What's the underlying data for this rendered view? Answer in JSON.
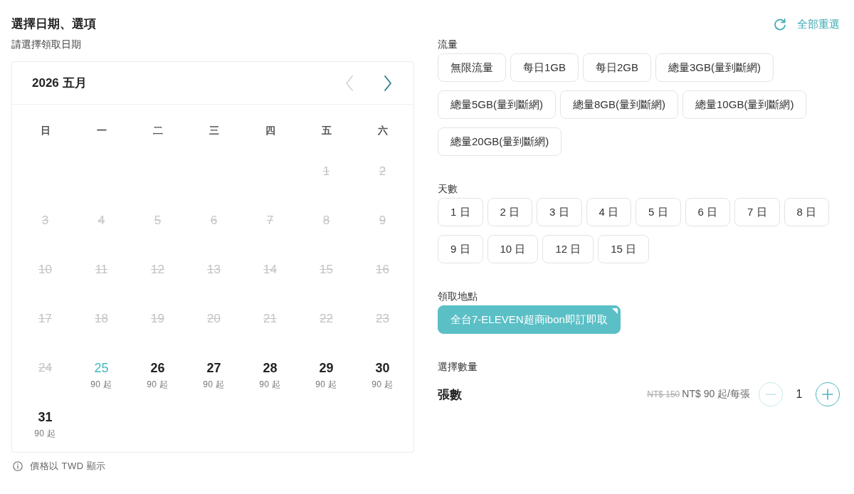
{
  "header": {
    "title": "選擇日期、選項",
    "subtitle": "請選擇領取日期",
    "reset": {
      "label": "全部重選"
    }
  },
  "calendar": {
    "title": "2026 五月",
    "prev": {
      "disabled": true
    },
    "next": {
      "disabled": false
    },
    "weekdays": [
      "日",
      "一",
      "二",
      "三",
      "四",
      "五",
      "六"
    ],
    "weeks": [
      [
        {
          "day": "1",
          "disabled": true,
          "selected": false
        },
        {
          "day": "2",
          "disabled": true,
          "selected": false
        }
      ],
      [
        {
          "day": "3",
          "disabled": true,
          "selected": false
        },
        {
          "day": "4",
          "disabled": true,
          "selected": false
        },
        {
          "day": "5",
          "disabled": true,
          "selected": false
        },
        {
          "day": "6",
          "disabled": true,
          "selected": false
        },
        {
          "day": "7",
          "disabled": true,
          "selected": false
        },
        {
          "day": "8",
          "disabled": true,
          "selected": false
        },
        {
          "day": "9",
          "disabled": true,
          "selected": false
        }
      ],
      [
        {
          "day": "10",
          "disabled": true,
          "selected": false
        },
        {
          "day": "11",
          "disabled": true,
          "selected": false
        },
        {
          "day": "12",
          "disabled": true,
          "selected": false
        },
        {
          "day": "13",
          "disabled": true,
          "selected": false
        },
        {
          "day": "14",
          "disabled": true,
          "selected": false
        },
        {
          "day": "15",
          "disabled": true,
          "selected": false
        },
        {
          "day": "16",
          "disabled": true,
          "selected": false
        }
      ],
      [
        {
          "day": "17",
          "disabled": true,
          "selected": false
        },
        {
          "day": "18",
          "disabled": true,
          "selected": false
        },
        {
          "day": "19",
          "disabled": true,
          "selected": false
        },
        {
          "day": "20",
          "disabled": true,
          "selected": false
        },
        {
          "day": "21",
          "disabled": true,
          "selected": false
        },
        {
          "day": "22",
          "disabled": true,
          "selected": false
        },
        {
          "day": "23",
          "disabled": true,
          "selected": false
        }
      ],
      [
        {
          "day": "24",
          "disabled": true,
          "selected": false
        },
        {
          "day": "25",
          "disabled": false,
          "selected": true,
          "price": "90 起"
        },
        {
          "day": "26",
          "disabled": false,
          "selected": false,
          "price": "90 起"
        },
        {
          "day": "27",
          "disabled": false,
          "selected": false,
          "price": "90 起"
        },
        {
          "day": "28",
          "disabled": false,
          "selected": false,
          "price": "90 起"
        },
        {
          "day": "29",
          "disabled": false,
          "selected": false,
          "price": "90 起"
        },
        {
          "day": "30",
          "disabled": false,
          "selected": false,
          "price": "90 起"
        }
      ],
      [
        {
          "day": "31",
          "disabled": false,
          "selected": false,
          "price": "90 起"
        }
      ]
    ]
  },
  "price_note": {
    "text": "價格以 TWD 顯示"
  },
  "sections": [
    {
      "label": "流量",
      "options": [
        {
          "label": "無限流量",
          "selected": false
        },
        {
          "label": "每日1GB",
          "selected": false
        },
        {
          "label": "每日2GB",
          "selected": false
        },
        {
          "label": "總量3GB(量到斷網)",
          "selected": false
        },
        {
          "label": "總量5GB(量到斷網)",
          "selected": false
        },
        {
          "label": "總量8GB(量到斷網)",
          "selected": false
        },
        {
          "label": "總量10GB(量到斷網)",
          "selected": false
        },
        {
          "label": "總量20GB(量到斷網)",
          "selected": false
        }
      ]
    },
    {
      "label": "天數",
      "options": [
        {
          "label": "1 日",
          "selected": false
        },
        {
          "label": "2 日",
          "selected": false
        },
        {
          "label": "3 日",
          "selected": false
        },
        {
          "label": "4 日",
          "selected": false
        },
        {
          "label": "5 日",
          "selected": false
        },
        {
          "label": "6 日",
          "selected": false
        },
        {
          "label": "7 日",
          "selected": false
        },
        {
          "label": "8 日",
          "selected": false
        },
        {
          "label": "9 日",
          "selected": false
        },
        {
          "label": "10 日",
          "selected": false
        },
        {
          "label": "12 日",
          "selected": false
        },
        {
          "label": "15 日",
          "selected": false
        }
      ]
    },
    {
      "label": "領取地點",
      "options": [
        {
          "label": "全台7-ELEVEN超商ibon即訂即取",
          "selected": true
        }
      ]
    }
  ],
  "quantity": {
    "label": "選擇數量",
    "item": "張數",
    "original_price": "NT$ 150",
    "price": "NT$ 90 起/每張",
    "value": "1",
    "decrement": {
      "disabled": true
    },
    "increment": {
      "disabled": false
    }
  }
}
